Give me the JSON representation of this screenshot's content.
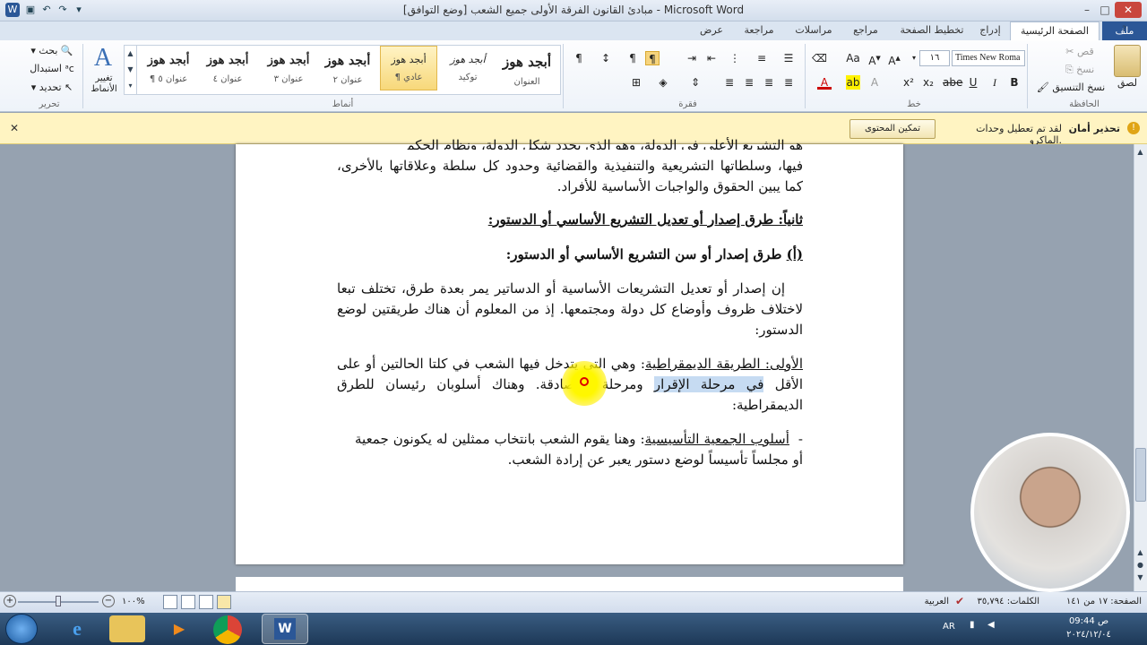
{
  "window": {
    "title": "مبادئ القانون الفرقة الأولى جميع الشعب [وضع التوافق] - Microsoft Word"
  },
  "tabs": [
    "ملف",
    "الصفحة الرئيسية",
    "إدراج",
    "تخطيط الصفحة",
    "مراجع",
    "مراسلات",
    "مراجعة",
    "عرض"
  ],
  "ribbon": {
    "groups": {
      "clipboard": "الحافظة",
      "font": "خط",
      "paragraph": "فقرة",
      "styles": "أنماط",
      "editing": "تحرير"
    },
    "clipboard": {
      "paste": "لصق",
      "cut": "قص",
      "copy": "نسخ",
      "format_painter": "نسخ التنسيق"
    },
    "font": {
      "name": "Times New Roma",
      "size": "١٦"
    },
    "styles": [
      {
        "sample": "أبجد هوز",
        "name": "العنوان"
      },
      {
        "sample": "أبجد هوز",
        "name": "توكيد"
      },
      {
        "sample": "أبجد هوز",
        "name": "¶ عادي"
      },
      {
        "sample": "أبجد هوز",
        "name": "عنوان ٢"
      },
      {
        "sample": "أبجد هوز",
        "name": "عنوان ٣"
      },
      {
        "sample": "أبجد هوز",
        "name": "عنوان ٤"
      },
      {
        "sample": "أبجد هوز",
        "name": "¶ عنوان ٥"
      }
    ],
    "change_styles": "تغيير الأنماط",
    "editing": {
      "find": "بحث",
      "replace": "استبدال",
      "select": "تحديد"
    }
  },
  "security": {
    "label": "تحذير أمان",
    "message": "لقد تم تعطيل وحدات الماكرو.",
    "button": "تمكين المحتوى"
  },
  "document": {
    "line0": "هو التشريع الأعلى في الدولة، وهو الذي يحدد شكل الدولة، ونظام الحكم",
    "p1": "فيها، وسلطاتها التشريعية والتنفيذية والقضائية وحدود كل سلطة وعلاقاتها بالأخرى، كما يبين الحقوق والواجبات الأساسية للأفراد.",
    "h1": "ثانياً: طرق إصدار أو تعديل التشريع الأساسي أو الدستور:",
    "h2_prefix": "(أ)",
    "h2": " طرق إصدار أو سن التشريع الأساسي أو الدستور:",
    "p2": "إن إصدار أو تعديل التشريعات الأساسية أو الدساتير يمر بعدة طرق، تختلف تبعا لاختلاف ظروف وأوضاع كل دولة ومجتمعها. إذ من المعلوم أن هناك طريقتين لوضع الدستور:",
    "p3_head": "الأولى: الطريقة الديمقراطية",
    "p3_a": ": وهي التي يتدخل فيها الشعب في كلتا الحالتين أو على الأقل ",
    "p3_hl": "في مرحلة الإقرار",
    "p3_b": " ومرحلة المصادقة. وهناك أسلوبان رئيسان للطرق الديمقراطية:",
    "p4_dash": "-",
    "p4_head": "أسلوب الجمعية التأسيسية",
    "p4_text": ": وهنا يقوم الشعب بانتخاب ممثلين له يكونون جمعية أو مجلساً تأسيساً لوضع دستور يعبر عن إرادة الشعب."
  },
  "status": {
    "page": "الصفحة: ١٧ من ١٤١",
    "words": "الكلمات: ٣٥,٧٩٤",
    "language": "العربية",
    "zoom": "١٠٠%"
  },
  "taskbar": {
    "lang": "AR",
    "time": "ص 09:44",
    "date": "٢٠٢٤/١٢/٠٤"
  },
  "colors": {
    "file_tab": "#2b5797",
    "security_bar": "#fff4c2",
    "highlight": "#c6dbf2",
    "pointer": "#ffee00"
  }
}
